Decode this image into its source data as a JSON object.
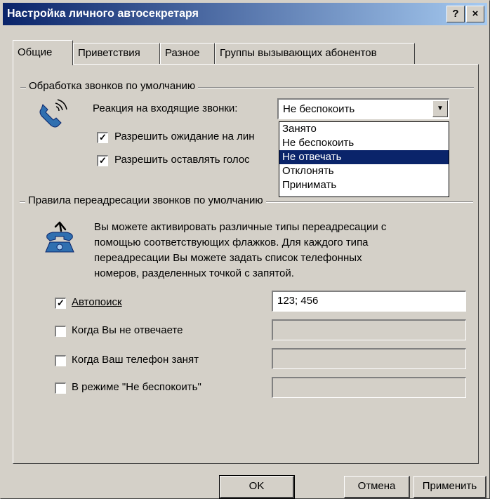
{
  "window": {
    "title": "Настройка личного автосекретаря",
    "help_button": "?",
    "close_button": "×"
  },
  "tabs": [
    {
      "label": "Общие",
      "active": true
    },
    {
      "label": "Приветствия"
    },
    {
      "label": "Разное"
    },
    {
      "label": "Группы вызывающих абонентов"
    }
  ],
  "call_handling": {
    "group_title": "Обработка звонков по умолчанию",
    "incoming_label": "Реакция на входящие звонки:",
    "incoming_value": "Не беспокоить",
    "options": [
      "Занято",
      "Не беспокоить",
      "Не отвечать",
      "Отклонять",
      "Принимать"
    ],
    "highlighted_option": "Не отвечать",
    "checkbox1_label": "Разрешить ожидание на лин",
    "checkbox2_label": "Разрешить оставлять голос"
  },
  "forwarding": {
    "group_title": "Правила переадресации звонков по умолчанию",
    "description_lines": [
      "Вы можете активировать различные типы переадресации с",
      "помощью соответствующих флажков. Для каждого типа",
      "переадресации Вы можете задать список телефонных",
      "номеров, разделенных точкой с запятой."
    ],
    "rules": [
      {
        "label": "Автопоиск",
        "checked": true,
        "value": "123; 456"
      },
      {
        "label": "Когда Вы не отвечаете",
        "checked": false,
        "value": ""
      },
      {
        "label": "Когда Ваш телефон занят",
        "checked": false,
        "value": ""
      },
      {
        "label": "В режиме \"Не беспокоить\"",
        "checked": false,
        "value": ""
      }
    ]
  },
  "buttons": {
    "ok": "OK",
    "cancel": "Отмена",
    "apply": "Применить"
  },
  "colors": {
    "face": "#d4d0c8",
    "title_start": "#0a246a",
    "title_end": "#a6caf0",
    "selection": "#0a246a"
  }
}
